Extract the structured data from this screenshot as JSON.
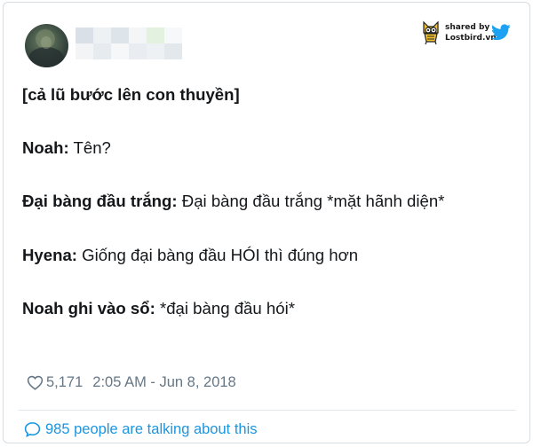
{
  "brand": {
    "shared_by": "shared by",
    "site": "Lostbird.vn",
    "logo_icon": "owl-logo-icon",
    "platform_icon": "twitter-bird-icon",
    "colors": {
      "twitter_blue": "#1da1f2",
      "owl_yellow": "#f2c230"
    }
  },
  "tweet": {
    "lines": [
      {
        "speaker": "",
        "text": "[cả lũ bước lên con thuyền]"
      },
      {
        "speaker": "Noah:",
        "text": " Tên?"
      },
      {
        "speaker": "Đại bàng đầu trắng:",
        "text": " Đại bàng đầu trắng *mặt hãnh diện*"
      },
      {
        "speaker": "Hyena:",
        "text": " Giống đại bàng đầu HÓI thì đúng hơn"
      },
      {
        "speaker": "Noah ghi vào sổ:",
        "text": " *đại bàng đầu hói*"
      }
    ]
  },
  "meta": {
    "likes": "5,171",
    "timestamp": "2:05 AM - Jun 8, 2018",
    "like_icon": "heart-icon"
  },
  "talking": {
    "label": "985 people are talking about this",
    "icon": "speech-bubble-icon",
    "color": "#1b95e0"
  }
}
